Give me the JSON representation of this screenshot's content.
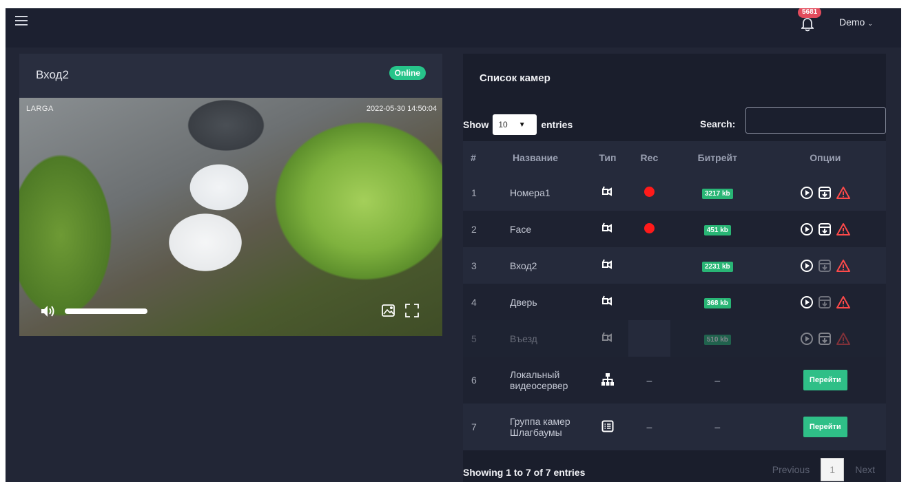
{
  "header": {
    "menu_icon": "hamburger-icon",
    "notification_count": "5681",
    "user_label": "Demo"
  },
  "camera_view": {
    "title": "Вход2",
    "status": "Online",
    "overlay_left": "LARGA",
    "overlay_right": "2022-05-30 14:50:04",
    "volume_level": 1.0
  },
  "camera_list": {
    "title": "Список камер",
    "show_label": "Show",
    "entries_value": "10",
    "entries_label": "entries",
    "search_label": "Search:",
    "search_value": "",
    "columns": [
      "#",
      "Название",
      "Тип",
      "Rec",
      "Битрейт",
      "Опции"
    ],
    "rows": [
      {
        "num": "1",
        "name": "Номера1",
        "type": "camera-icon",
        "rec": true,
        "bitrate": "3217 kb",
        "archive_enabled": true,
        "disabled": false
      },
      {
        "num": "2",
        "name": "Face",
        "type": "camera-icon",
        "rec": true,
        "bitrate": "451 kb",
        "archive_enabled": true,
        "disabled": false
      },
      {
        "num": "3",
        "name": "Вход2",
        "type": "camera-icon",
        "rec": false,
        "bitrate": "2231 kb",
        "archive_enabled": false,
        "disabled": false
      },
      {
        "num": "4",
        "name": "Дверь",
        "type": "camera-icon",
        "rec": false,
        "bitrate": "368 kb",
        "archive_enabled": false,
        "disabled": false
      },
      {
        "num": "5",
        "name": "Въезд",
        "type": "camera-icon",
        "rec": false,
        "bitrate": "510 kb",
        "archive_enabled": true,
        "disabled": true
      },
      {
        "num": "6",
        "name_line1": "Локальный",
        "name_line2": "видеосервер",
        "type": "network-icon",
        "rec_text": "–",
        "bitrate_text": "–",
        "button": "Перейти"
      },
      {
        "num": "7",
        "name_line1": "Группа камер",
        "name_line2": "Шлагбаумы",
        "type": "list-icon",
        "rec_text": "–",
        "bitrate_text": "–",
        "button": "Перейти"
      }
    ],
    "footer_info": "Showing 1 to 7 of 7 entries",
    "pagination": {
      "previous": "Previous",
      "current": "1",
      "next": "Next"
    }
  },
  "colors": {
    "page_bg": "#222636",
    "panel_bg": "#1a1e2c",
    "accent_green": "#27c48a",
    "badge_red": "#e24b5c",
    "rec_red": "#ff1a1a",
    "warning_red": "#ff4a4a"
  }
}
